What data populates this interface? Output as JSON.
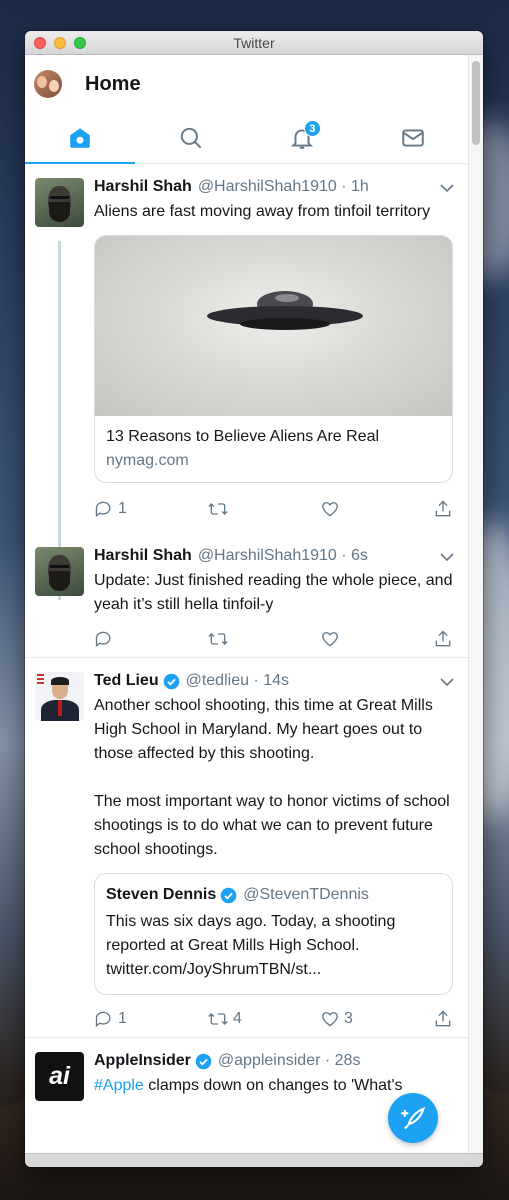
{
  "window": {
    "title": "Twitter"
  },
  "header": {
    "title": "Home"
  },
  "tabs": [
    {
      "name": "home",
      "icon": "home-icon",
      "active": true
    },
    {
      "name": "search",
      "icon": "search-icon"
    },
    {
      "name": "notifications",
      "icon": "bell-icon",
      "badge": "3"
    },
    {
      "name": "messages",
      "icon": "mail-icon"
    }
  ],
  "colors": {
    "accent": "#1da1f2",
    "text": "#14171a",
    "muted": "#657786"
  },
  "tweets": [
    {
      "name": "Harshil Shah",
      "handle": "@HarshilShah1910 · 1h",
      "text": "Aliens are fast moving away from tinfoil territory",
      "card": {
        "title": "13 Reasons to Believe Aliens Are Real",
        "domain": "nymag.com"
      },
      "replies": "1",
      "retweets": "",
      "likes": ""
    },
    {
      "name": "Harshil Shah",
      "handle": "@HarshilShah1910 · 6s",
      "text": "Update: Just finished reading the whole piece, and yeah it’s still hella tinfoil-y",
      "replies": "",
      "retweets": "",
      "likes": ""
    },
    {
      "name": "Ted Lieu",
      "handle": "@tedlieu · 14s",
      "text1": "Another school shooting, this time at Great Mills High School in Maryland. My heart goes out to those affected by this shooting.",
      "text2": "The most important way to honor victims of school shootings is to do what we can to prevent future school shootings.",
      "quote": {
        "name": "Steven Dennis",
        "handle": "@StevenTDennis",
        "text": "This was six days ago. Today, a shooting reported at Great Mills High School. twitter.com/JoyShrumTBN/st..."
      },
      "replies": "1",
      "retweets": "4",
      "likes": "3"
    },
    {
      "name": "AppleInsider",
      "handle": "@appleinsider · 28s",
      "avatar_text": "ai",
      "hashtag": "#Apple",
      "text": " clamps down on changes to 'What's"
    }
  ]
}
